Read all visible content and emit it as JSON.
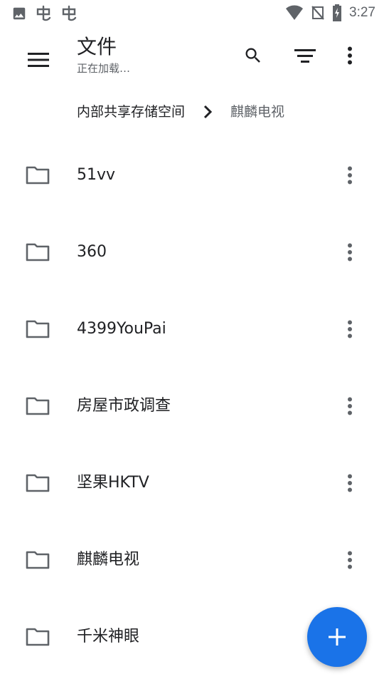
{
  "status_bar": {
    "time": "3:27",
    "left_icons": [
      "image-icon",
      "app-icon",
      "app-icon"
    ],
    "right_icons": [
      "wifi-icon",
      "no-signal-icon",
      "battery-charging-icon"
    ]
  },
  "app_bar": {
    "title": "文件",
    "subtitle": "正在加载…",
    "icons": [
      "menu-icon",
      "search-icon",
      "sort-icon",
      "more-vert-icon"
    ]
  },
  "breadcrumb": {
    "root": "内部共享存储空间",
    "current": "麒麟电视"
  },
  "files": [
    {
      "name": "51vv",
      "type": "folder"
    },
    {
      "name": "360",
      "type": "folder"
    },
    {
      "name": "4399YouPai",
      "type": "folder"
    },
    {
      "name": "房屋市政调查",
      "type": "folder"
    },
    {
      "name": "坚果HKTV",
      "type": "folder"
    },
    {
      "name": "麒麟电视",
      "type": "folder"
    },
    {
      "name": "千米神眼",
      "type": "folder"
    }
  ],
  "fab": {
    "icon": "add-icon"
  },
  "colors": {
    "accent": "#1a73e8",
    "icon_gray": "#5f6368",
    "text_dark": "#202124"
  }
}
